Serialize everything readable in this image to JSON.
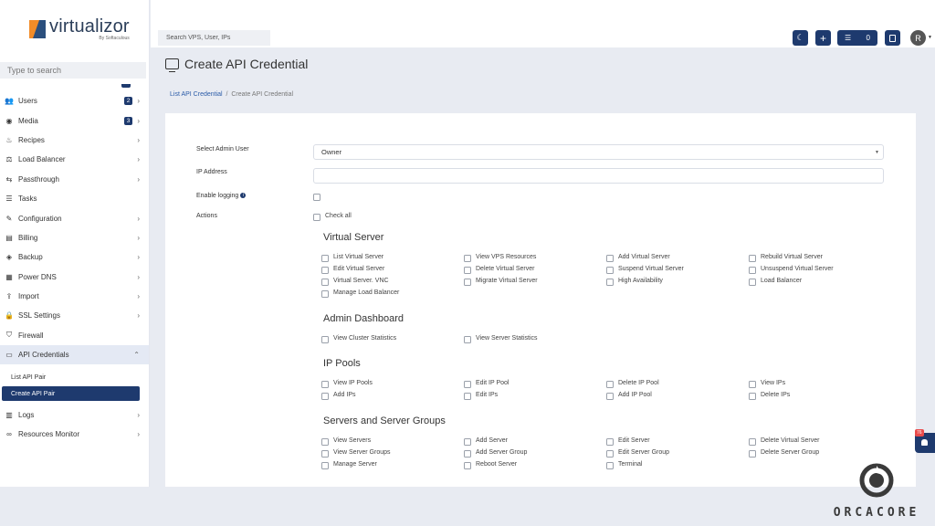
{
  "brand": {
    "name": "virtualizor",
    "sub": "By Softaculous"
  },
  "sidebar": {
    "search_placeholder": "Type to search",
    "items": [
      {
        "label": "Users",
        "badge": "2",
        "icon": "users-icon"
      },
      {
        "label": "Media",
        "badge": "3",
        "icon": "media-icon"
      },
      {
        "label": "Recipes",
        "icon": "recipes-icon"
      },
      {
        "label": "Load Balancer",
        "icon": "load-balancer-icon"
      },
      {
        "label": "Passthrough",
        "icon": "usb-icon"
      },
      {
        "label": "Tasks",
        "icon": "tasks-icon"
      },
      {
        "label": "Configuration",
        "icon": "wrench-icon"
      },
      {
        "label": "Billing",
        "icon": "billing-icon"
      },
      {
        "label": "Backup",
        "icon": "backup-icon"
      },
      {
        "label": "Power DNS",
        "icon": "server-icon"
      },
      {
        "label": "Import",
        "icon": "import-icon"
      },
      {
        "label": "SSL Settings",
        "icon": "lock-icon"
      },
      {
        "label": "Firewall",
        "icon": "shield-icon"
      },
      {
        "label": "API Credentials",
        "icon": "laptop-icon"
      },
      {
        "label": "Logs",
        "icon": "logs-icon"
      },
      {
        "label": "Resources Monitor",
        "icon": "binoculars-icon"
      }
    ],
    "sub_items": [
      "List API Pair",
      "Create API Pair"
    ]
  },
  "topbar": {
    "search_placeholder": "Search VPS, User, IPs",
    "task_count": "0",
    "avatar_initial": "R"
  },
  "page": {
    "title": "Create API Credential",
    "breadcrumb": {
      "link": "List API Credential",
      "sep": "/",
      "current": "Create API Credential"
    }
  },
  "form": {
    "admin_user_label": "Select Admin User",
    "admin_user_value": "Owner",
    "ip_label": "IP Address",
    "logging_label": "Enable logging",
    "actions_label": "Actions",
    "check_all": "Check all"
  },
  "sections": [
    {
      "title": "Virtual Server",
      "perms": [
        "List Virtual Server",
        "View VPS Resources",
        "Add Virtual Server",
        "Rebuild Virtual Server",
        "Edit Virtual Server",
        "Delete Virtual Server",
        "Suspend Virtual Server",
        "Unsuspend Virtual Server",
        "Virtual Server. VNC",
        "Migrate Virtual Server",
        "High Availability",
        "Load Balancer",
        "Manage Load Balancer"
      ]
    },
    {
      "title": "Admin Dashboard",
      "perms": [
        "View Cluster Statistics",
        "View Server Statistics"
      ]
    },
    {
      "title": "IP Pools",
      "perms": [
        "View IP Pools",
        "Edit IP Pool",
        "Delete IP Pool",
        "View IPs",
        "Add IPs",
        "Edit IPs",
        "Add IP Pool",
        "Delete IPs"
      ]
    },
    {
      "title": "Servers and Server Groups",
      "perms": [
        "View Servers",
        "Add Server",
        "Edit Server",
        "Delete Virtual Server",
        "View Server Groups",
        "Add Server Group",
        "Edit Server Group",
        "Delete Server Group",
        "Manage Server",
        "Reboot Server",
        "Terminal"
      ]
    }
  ],
  "notification": {
    "count": "76"
  },
  "watermark": {
    "text": "ORCACORE"
  },
  "colors": {
    "primary": "#1e3a6e",
    "accent": "#f28c28",
    "link": "#2b5ca8"
  }
}
